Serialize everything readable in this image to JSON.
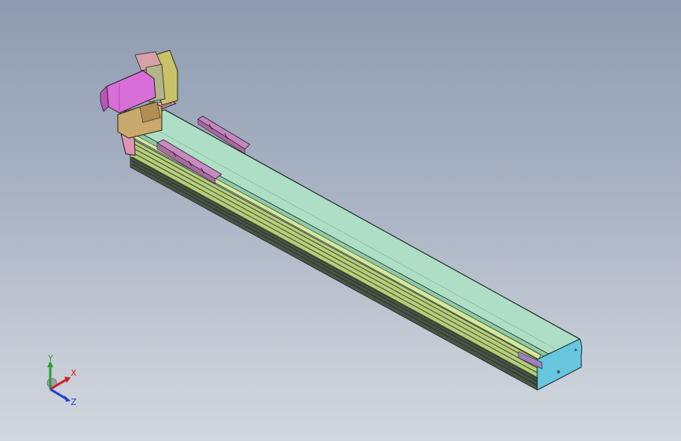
{
  "viewport": {
    "background_top": "#8e9bb0",
    "background_bottom": "#d2d6de"
  },
  "model": {
    "parts": {
      "motor": "motor",
      "motor_adapter": "motor-adapter",
      "motor_mount": "motor-mount-plate",
      "coupling_housing": "coupling-housing",
      "end_plate": "end-plate",
      "carriage": "carriage-block",
      "sensor_rail": "sensor-rail",
      "rail_body": "rail-body",
      "top_cover": "top-cover",
      "side_profile": "side-profile",
      "end_cap": "end-cap"
    },
    "colors": {
      "motor": "#d86fd8",
      "motor_mount": "#c9c36a",
      "coupling_housing": "#c7a86a",
      "end_plate": "#d78fb2",
      "carriage": "#c98ac0",
      "top_cover": "#a9dcc0",
      "side_profile": "#c4dd86",
      "end_cap": "#66c4de",
      "rail_dark": "#3d4a3b"
    }
  },
  "triad": {
    "x_label": "X",
    "y_label": "Y",
    "z_label": "Z",
    "x_color": "#d32020",
    "y_color": "#2aa02a",
    "z_color": "#2040d0"
  }
}
